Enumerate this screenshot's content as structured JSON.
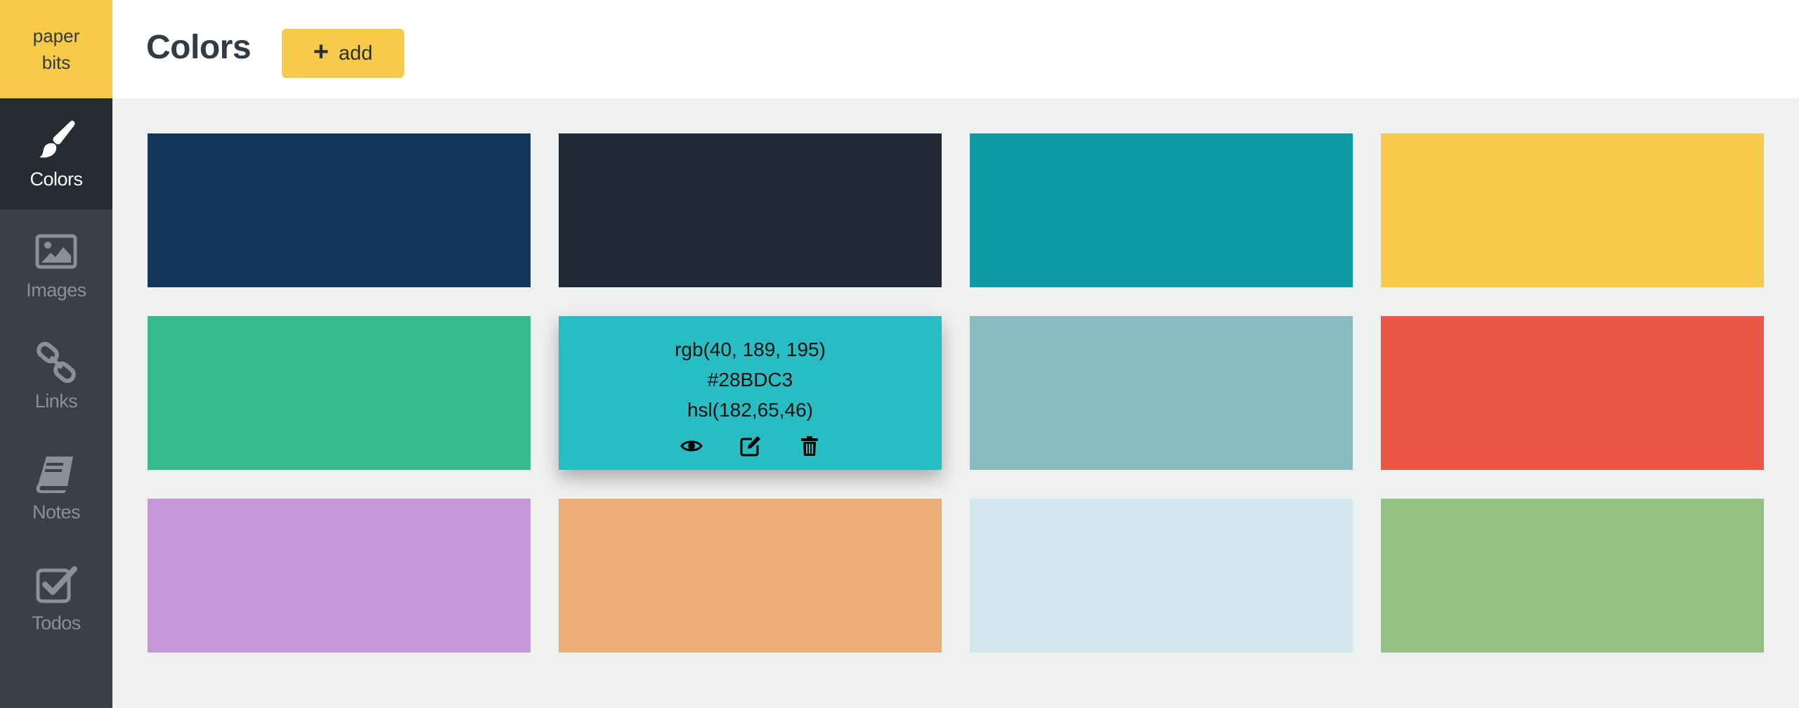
{
  "sidebar": {
    "logo_line1": "paper",
    "logo_line2": "bits",
    "items": [
      {
        "label": "Colors",
        "icon": "brush-icon",
        "active": true
      },
      {
        "label": "Images",
        "icon": "image-icon",
        "active": false
      },
      {
        "label": "Links",
        "icon": "link-icon",
        "active": false
      },
      {
        "label": "Notes",
        "icon": "book-icon",
        "active": false
      },
      {
        "label": "Todos",
        "icon": "checkbox-icon",
        "active": false
      }
    ]
  },
  "header": {
    "title": "Colors",
    "add_label": "add"
  },
  "colors": [
    {
      "hex": "#10365A"
    },
    {
      "hex": "#222836"
    },
    {
      "hex": "#0F9BA6"
    },
    {
      "hex": "#F8CA4A"
    },
    {
      "hex": "#37BA8C"
    },
    {
      "hex": "#28BDC3",
      "rgb": "rgb(40, 189, 195)",
      "hex_label": "#28BDC3",
      "hsl": "hsl(182,65,46)"
    },
    {
      "hex": "#89BBBF"
    },
    {
      "hex": "#EB5647"
    },
    {
      "hex": "#C597D9"
    },
    {
      "hex": "#EBAC77"
    },
    {
      "hex": "#D4E7EE"
    },
    {
      "hex": "#93C083"
    }
  ],
  "accent": "#F8CA4A"
}
